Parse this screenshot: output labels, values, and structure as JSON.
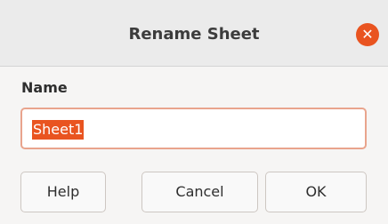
{
  "dialog": {
    "title": "Rename Sheet",
    "close_icon": "close-icon",
    "name_label": "Name",
    "name_value": "Sheet1",
    "buttons": {
      "help": "Help",
      "cancel": "Cancel",
      "ok": "OK"
    }
  },
  "colors": {
    "accent": "#e95420",
    "titlebar": "#ebebeb",
    "dialog_bg": "#f6f5f4"
  }
}
